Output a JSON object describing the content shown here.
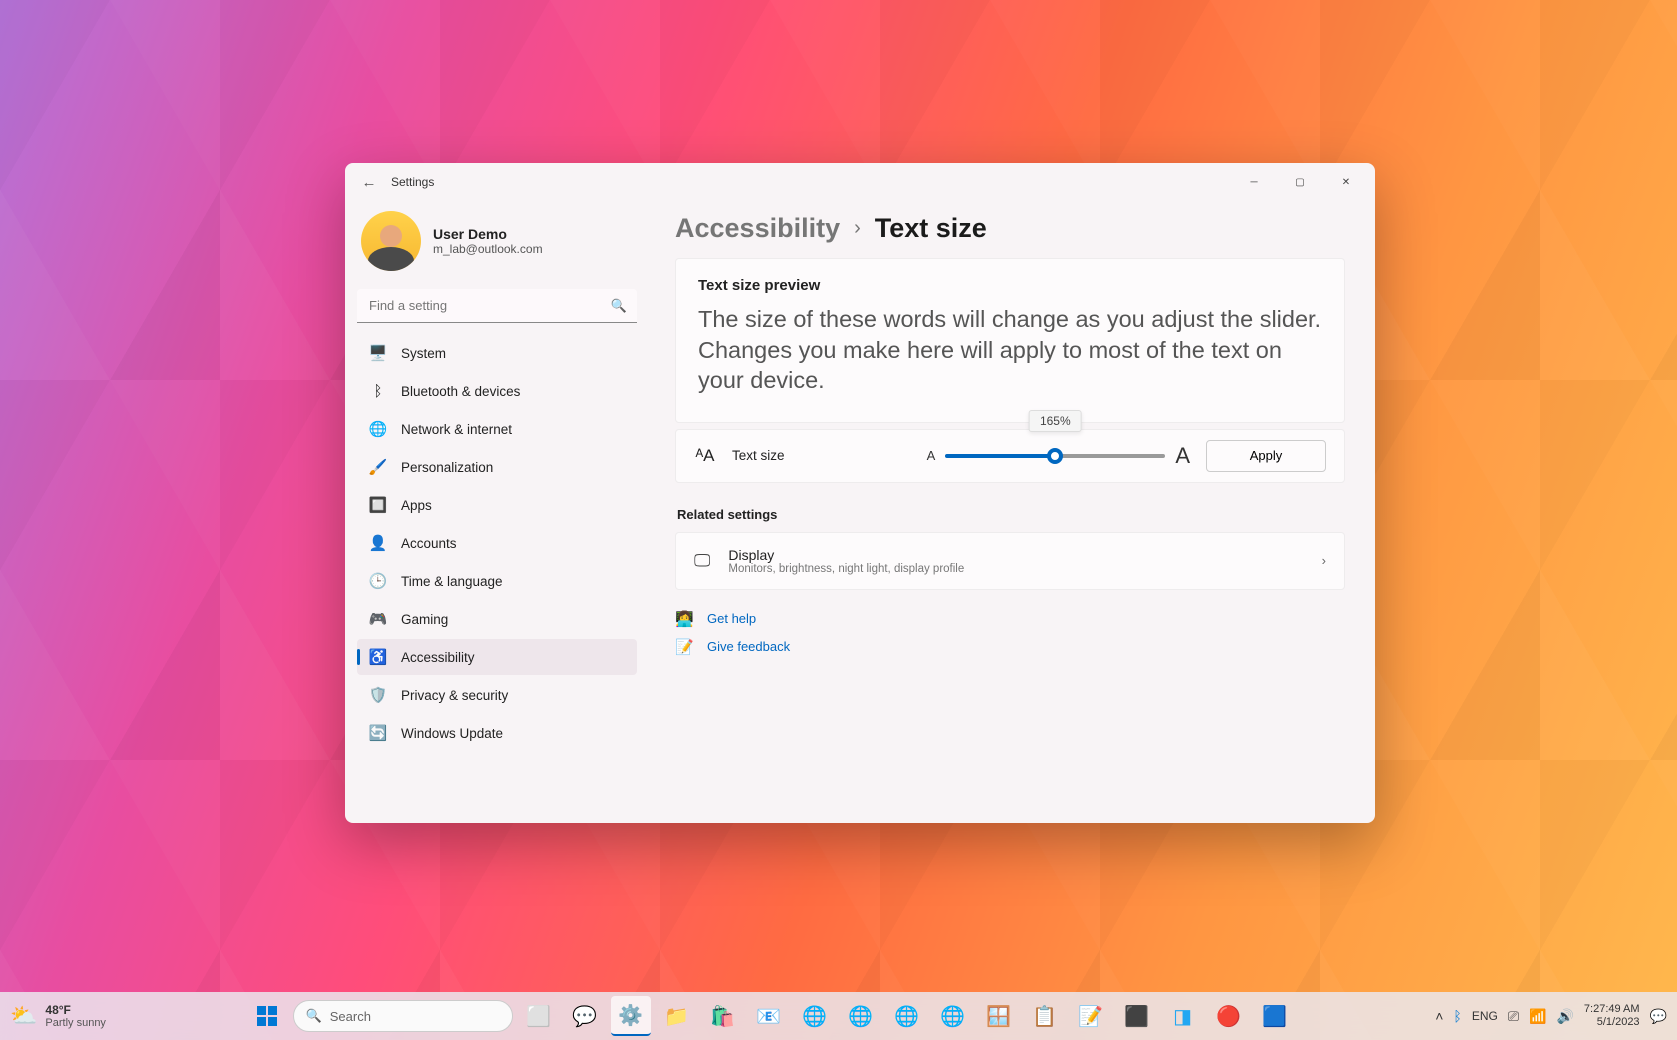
{
  "window": {
    "title": "Settings",
    "user": {
      "name": "User Demo",
      "email": "m_lab@outlook.com"
    },
    "search_placeholder": "Find a setting",
    "nav": [
      {
        "icon": "🖥️",
        "label": "System"
      },
      {
        "icon": "ᛒ",
        "label": "Bluetooth & devices"
      },
      {
        "icon": "🌐",
        "label": "Network & internet"
      },
      {
        "icon": "🖌️",
        "label": "Personalization"
      },
      {
        "icon": "🔲",
        "label": "Apps"
      },
      {
        "icon": "👤",
        "label": "Accounts"
      },
      {
        "icon": "🕒",
        "label": "Time & language"
      },
      {
        "icon": "🎮",
        "label": "Gaming"
      },
      {
        "icon": "♿",
        "label": "Accessibility"
      },
      {
        "icon": "🛡️",
        "label": "Privacy & security"
      },
      {
        "icon": "🔄",
        "label": "Windows Update"
      }
    ],
    "active_nav_index": 8,
    "breadcrumb": {
      "parent": "Accessibility",
      "current": "Text size"
    },
    "preview": {
      "heading": "Text size preview",
      "body": "The size of these words will change as you adjust the slider. Changes you make here will apply to most of the text on your device."
    },
    "slider": {
      "label": "Text size",
      "value_percent": "165%",
      "apply_label": "Apply"
    },
    "related": {
      "section_label": "Related settings",
      "title": "Display",
      "subtitle": "Monitors, brightness, night light, display profile"
    },
    "help": {
      "get_help": "Get help",
      "give_feedback": "Give feedback"
    }
  },
  "taskbar": {
    "weather": {
      "temp": "48°F",
      "desc": "Partly sunny"
    },
    "search_placeholder": "Search",
    "tray": {
      "lang": "ENG",
      "time": "7:27:49 AM",
      "date": "5/1/2023"
    }
  }
}
